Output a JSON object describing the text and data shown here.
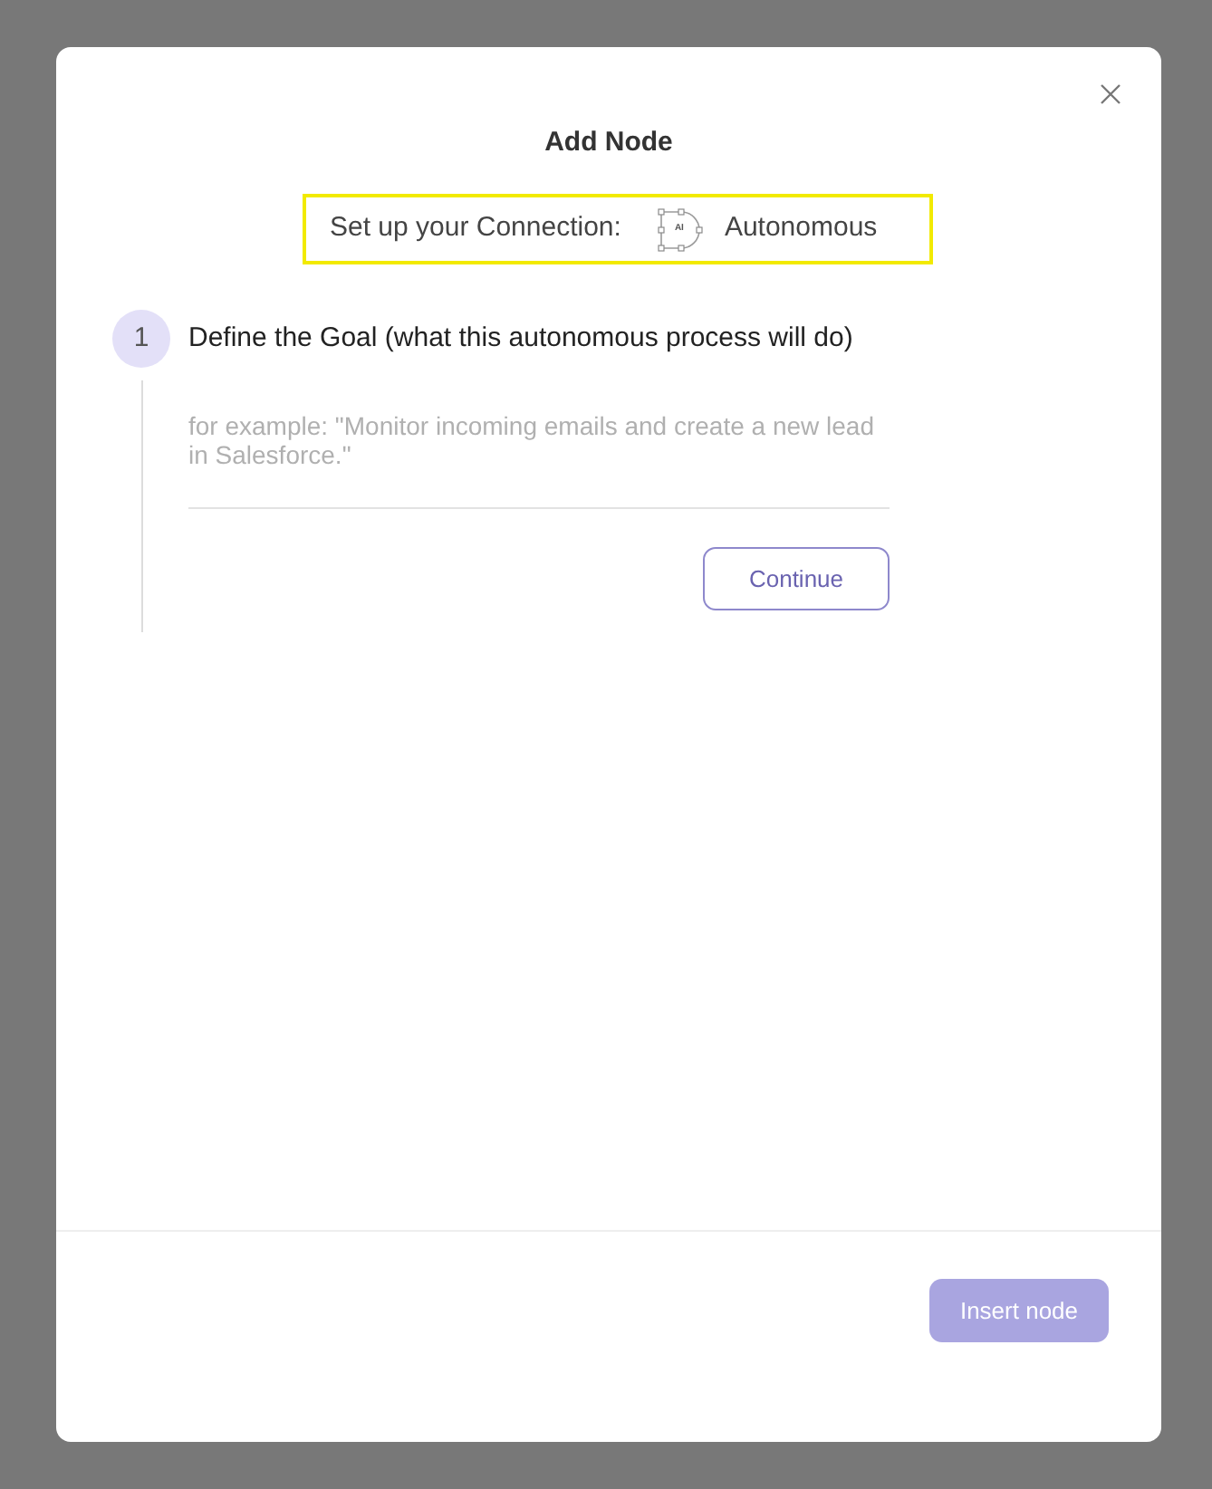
{
  "dialog": {
    "title": "Add Node"
  },
  "connection": {
    "label": "Set up your Connection:",
    "node_badge": "AI",
    "type": "Autonomous"
  },
  "steps": [
    {
      "number": "1",
      "title": "Define the Goal (what this autonomous process will do)",
      "input": {
        "placeholder": "for example: \"Monitor incoming emails and create a new lead in Salesforce.\""
      },
      "button": "Continue"
    }
  ],
  "footer": {
    "button": {
      "label": "Insert node",
      "disabled": true
    }
  }
}
